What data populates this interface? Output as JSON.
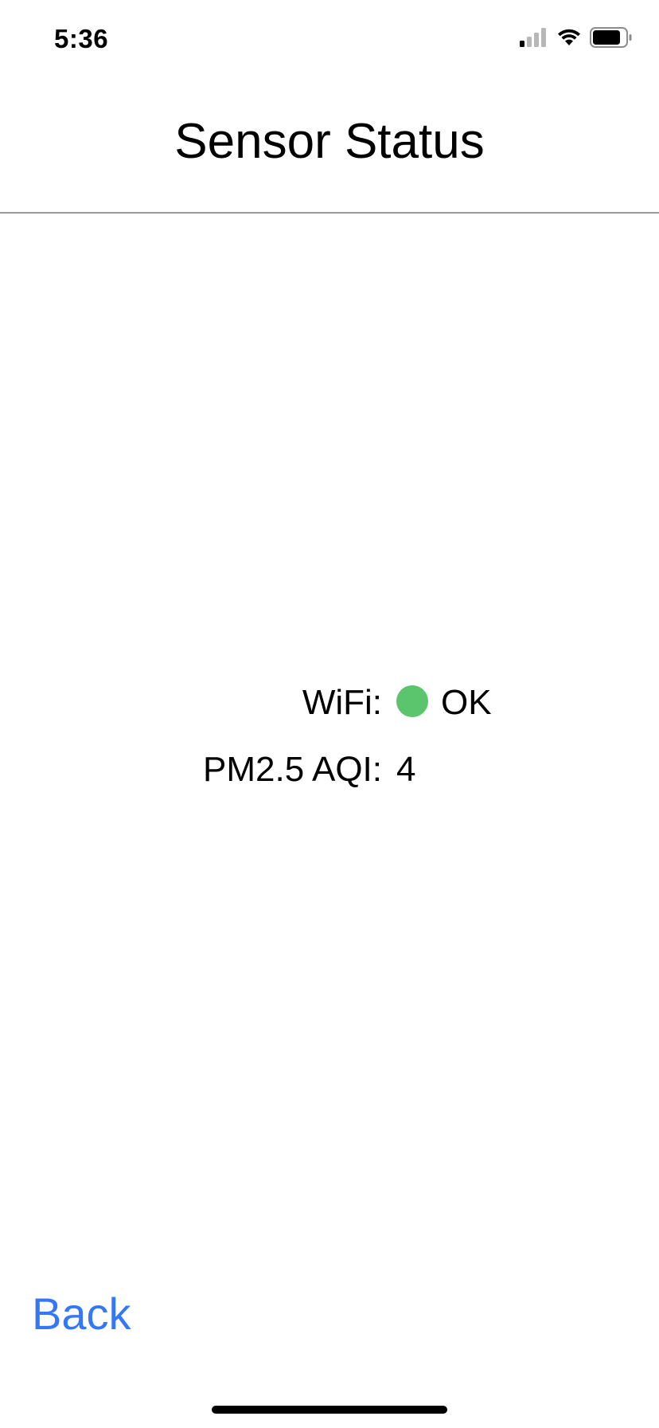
{
  "status_bar": {
    "time": "5:36",
    "icons": [
      "cellular-signal-icon",
      "wifi-icon",
      "battery-icon"
    ]
  },
  "header": {
    "title": "Sensor Status"
  },
  "sensors": {
    "wifi": {
      "label": "WiFi:",
      "status_text": "OK",
      "status_color": "#5ac56c"
    },
    "aqi": {
      "label": "PM2.5 AQI:",
      "value": "4"
    }
  },
  "footer": {
    "back_label": "Back",
    "back_color": "#3478f6"
  }
}
